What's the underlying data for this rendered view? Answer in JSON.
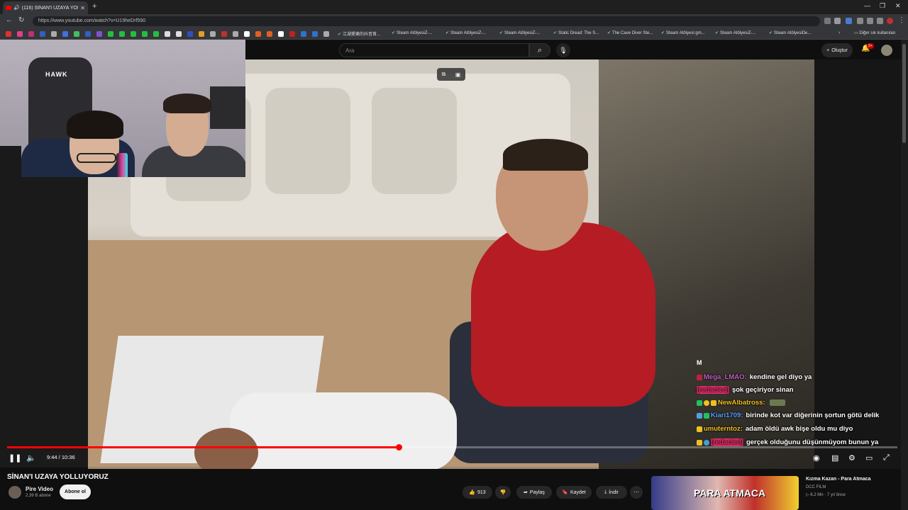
{
  "browser": {
    "tab_title": "(116) SİNAN'I UZAYA YOLLUYORUZ",
    "url": "https://www.youtube.com/watch?v=U19heDrf590",
    "bookmarks": [
      "江湖愛樂的抖音首...",
      "Steam AtölyesiZ-...",
      "Steam AtölyesiZ-...",
      "Steam AtölyesiZ-...",
      "Static Dread: The S...",
      "The Cave Diver Ste...",
      "Steam Atölyesi:gm...",
      "Steam AtölyesiZ-...",
      "Steam AtölyesiDe..."
    ],
    "other_bookmarks": "Diğer sık kullanılan"
  },
  "header": {
    "search_placeholder": "Ara",
    "create_label": "Oluştur",
    "notif_count": "9+"
  },
  "webcam": {
    "chair_brand": "HAWK"
  },
  "chat": {
    "header": "M",
    "messages": [
      {
        "user": "Mega_LMAO:",
        "text": "kendine gel diyo ya",
        "color": "#c65ec6"
      },
      {
        "user": "[redacted]",
        "text": "şok geçiriyor sinan",
        "color": "#e0306a"
      },
      {
        "user": "NewAlbatross:",
        "text": "",
        "color": "#f0c020"
      },
      {
        "user": "Kiari1709:",
        "text": "birinde kot var diğerinin şortun götü delik",
        "color": "#5aa0ff"
      },
      {
        "user": "umuterntoz:",
        "text": "adam öldü awk bişe oldu mu diyo",
        "color": "#f0c020"
      },
      {
        "user": "[redacted]",
        "text": "gerçek olduğunu düşünmüyom bunun ya",
        "color": "#e0306a"
      }
    ]
  },
  "player": {
    "time": "9:44 / 10:36",
    "progress": 0.44
  },
  "video": {
    "title": "SİNAN'I UZAYA YOLLUYORUZ",
    "channel": "Pire Video",
    "subscribers": "2,39 B abone",
    "subscribe_label": "Abone ol",
    "likes": "913",
    "share_label": "Paylaş",
    "save_label": "Kaydet",
    "download_label": "İndir"
  },
  "recommendation": {
    "title": "Kızma Kazan - Para Atmaca",
    "channel": "DCC FILM",
    "views": "6,2 Mn",
    "age": "7 yıl önce",
    "thumb_text": "PARA ATMACA"
  }
}
